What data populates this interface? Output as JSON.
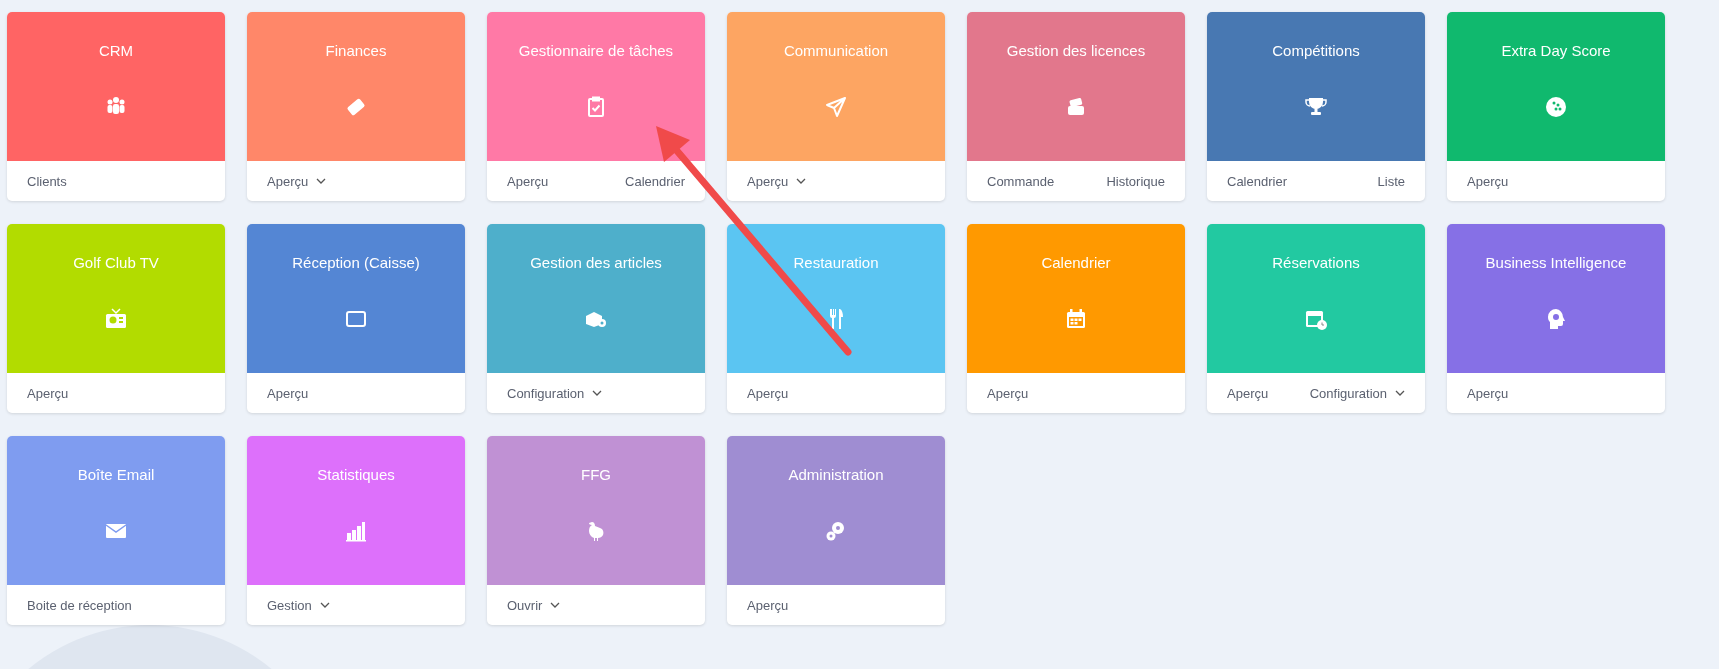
{
  "apps": [
    {
      "title": "CRM",
      "color": "#ff6464",
      "kind": "people",
      "links": [
        {
          "label": "Clients",
          "dropdown": false
        }
      ]
    },
    {
      "title": "Finances",
      "color": "#ff8769",
      "kind": "card",
      "links": [
        {
          "label": "Aperçu",
          "dropdown": true
        }
      ]
    },
    {
      "title": "Gestionnaire de tâches",
      "color": "#ff79a6",
      "kind": "clipboard",
      "links": [
        {
          "label": "Aperçu",
          "dropdown": false
        },
        {
          "label": "Calendrier",
          "dropdown": false
        }
      ]
    },
    {
      "title": "Communication",
      "color": "#fda562",
      "kind": "plane",
      "links": [
        {
          "label": "Aperçu",
          "dropdown": true
        }
      ]
    },
    {
      "title": "Gestion des licences",
      "color": "#e2778c",
      "kind": "cards",
      "links": [
        {
          "label": "Commande",
          "dropdown": false
        },
        {
          "label": "Historique",
          "dropdown": false
        }
      ]
    },
    {
      "title": "Compétitions",
      "color": "#4878b2",
      "kind": "trophy",
      "links": [
        {
          "label": "Calendrier",
          "dropdown": false
        },
        {
          "label": "Liste",
          "dropdown": false
        }
      ]
    },
    {
      "title": "Extra Day Score",
      "color": "#10b96e",
      "kind": "ball",
      "links": [
        {
          "label": "Aperçu",
          "dropdown": false
        }
      ]
    },
    {
      "title": "Golf Club TV",
      "color": "#b2dc00",
      "kind": "tv",
      "links": [
        {
          "label": "Aperçu",
          "dropdown": false
        }
      ]
    },
    {
      "title": "Réception (Caisse)",
      "color": "#5486d4",
      "kind": "tablet",
      "links": [
        {
          "label": "Aperçu",
          "dropdown": false
        }
      ]
    },
    {
      "title": "Gestion des articles",
      "color": "#4eafcb",
      "kind": "box",
      "links": [
        {
          "label": "Configuration",
          "dropdown": true
        }
      ]
    },
    {
      "title": "Restauration",
      "color": "#5bc5f2",
      "kind": "cutlery",
      "links": [
        {
          "label": "Aperçu",
          "dropdown": false
        }
      ]
    },
    {
      "title": "Calendrier",
      "color": "#ff9900",
      "kind": "calendar",
      "links": [
        {
          "label": "Aperçu",
          "dropdown": false
        }
      ]
    },
    {
      "title": "Réservations",
      "color": "#22c9a1",
      "kind": "calclock",
      "links": [
        {
          "label": "Aperçu",
          "dropdown": false
        },
        {
          "label": "Configuration",
          "dropdown": true
        }
      ]
    },
    {
      "title": "Business Intelligence",
      "color": "#8670e6",
      "kind": "head",
      "links": [
        {
          "label": "Aperçu",
          "dropdown": false
        }
      ]
    },
    {
      "title": "Boîte Email",
      "color": "#7f9cf0",
      "kind": "mail",
      "links": [
        {
          "label": "Boite de réception",
          "dropdown": false
        }
      ]
    },
    {
      "title": "Statistiques",
      "color": "#dd70fb",
      "kind": "bars",
      "links": [
        {
          "label": "Gestion",
          "dropdown": true
        }
      ]
    },
    {
      "title": "FFG",
      "color": "#c091d4",
      "kind": "rooster",
      "links": [
        {
          "label": "Ouvrir",
          "dropdown": true
        }
      ]
    },
    {
      "title": "Administration",
      "color": "#9f8dd2",
      "kind": "gears",
      "links": [
        {
          "label": "Aperçu",
          "dropdown": false
        }
      ]
    }
  ]
}
